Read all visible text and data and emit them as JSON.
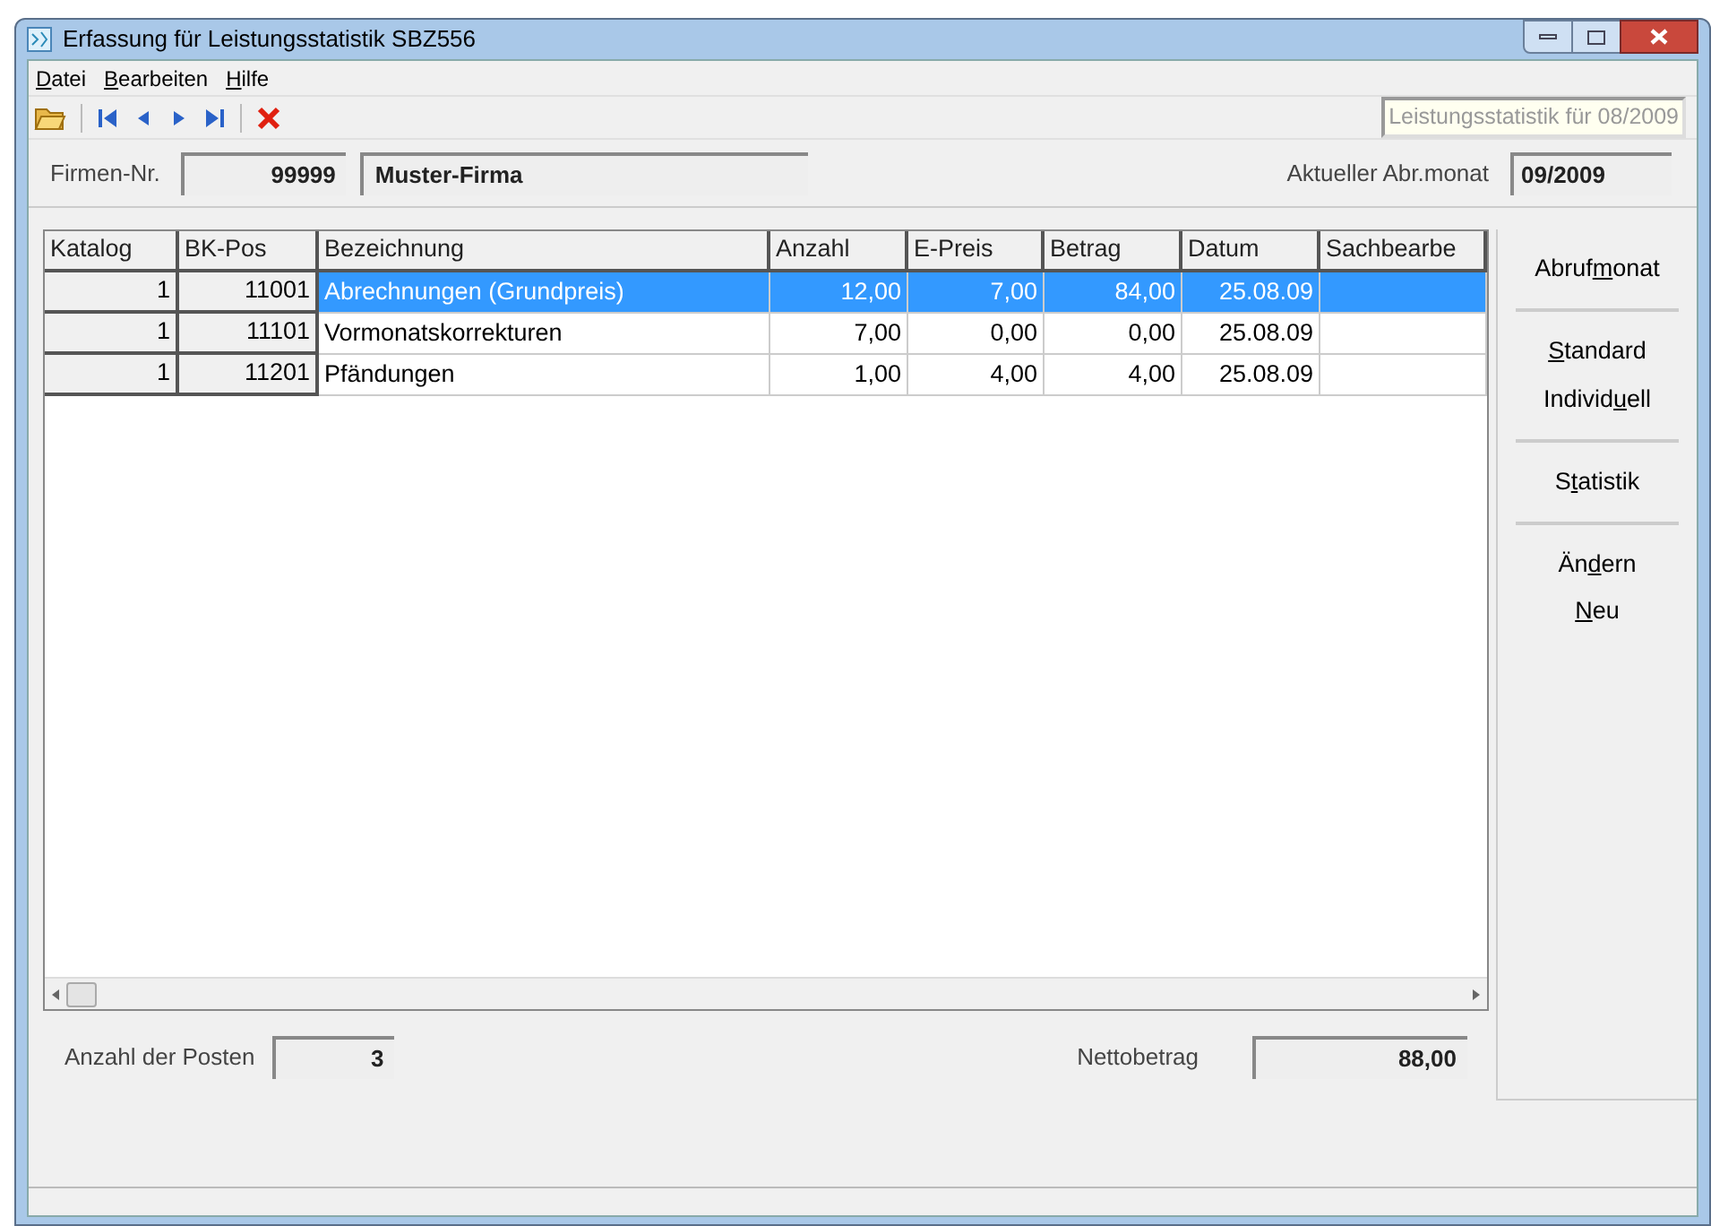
{
  "window": {
    "title": "Erfassung für Leistungsstatistik SBZ556"
  },
  "menu": [
    {
      "key": "D",
      "after": "atei"
    },
    {
      "key": "B",
      "after": "earbeiten"
    },
    {
      "key": "H",
      "after": "ilfe"
    }
  ],
  "toolbar": {
    "period_label": "Leistungsstatistik für 08/2009"
  },
  "header": {
    "firm_label": "Firmen-Nr.",
    "firm_number": "99999",
    "firm_name": "Muster-Firma",
    "month_label": "Aktueller Abr.monat",
    "month_value": "09/2009"
  },
  "table": {
    "columns": [
      "Katalog",
      "BK-Pos",
      "Bezeichnung",
      "Anzahl",
      "E-Preis",
      "Betrag",
      "Datum",
      "Sachbearbe"
    ],
    "rows": [
      {
        "cells": [
          "1",
          "11001",
          "Abrechnungen (Grundpreis)",
          "12,00",
          "7,00",
          "84,00",
          "25.08.09"
        ],
        "selected": true
      },
      {
        "cells": [
          "1",
          "11101",
          "Vormonatskorrekturen",
          "7,00",
          "0,00",
          "0,00",
          "25.08.09"
        ],
        "selected": false
      },
      {
        "cells": [
          "1",
          "11201",
          "Pfändungen",
          "1,00",
          "4,00",
          "4,00",
          "25.08.09"
        ],
        "selected": false
      }
    ]
  },
  "side_buttons": [
    [
      {
        "before": "Abruf",
        "key": "m",
        "after": "onat"
      }
    ],
    [
      {
        "key": "S",
        "after": "tandard"
      },
      {
        "before": "Individ",
        "key": "u",
        "after": "ell"
      }
    ],
    [
      {
        "before": "S",
        "key": "t",
        "after": "atistik"
      }
    ],
    [
      {
        "before": "Än",
        "key": "d",
        "after": "ern"
      },
      {
        "key": "N",
        "after": "eu"
      }
    ]
  ],
  "footer": {
    "count_label": "Anzahl der Posten",
    "count_value": "3",
    "net_label": "Nettobetrag",
    "net_value": "88,00"
  }
}
